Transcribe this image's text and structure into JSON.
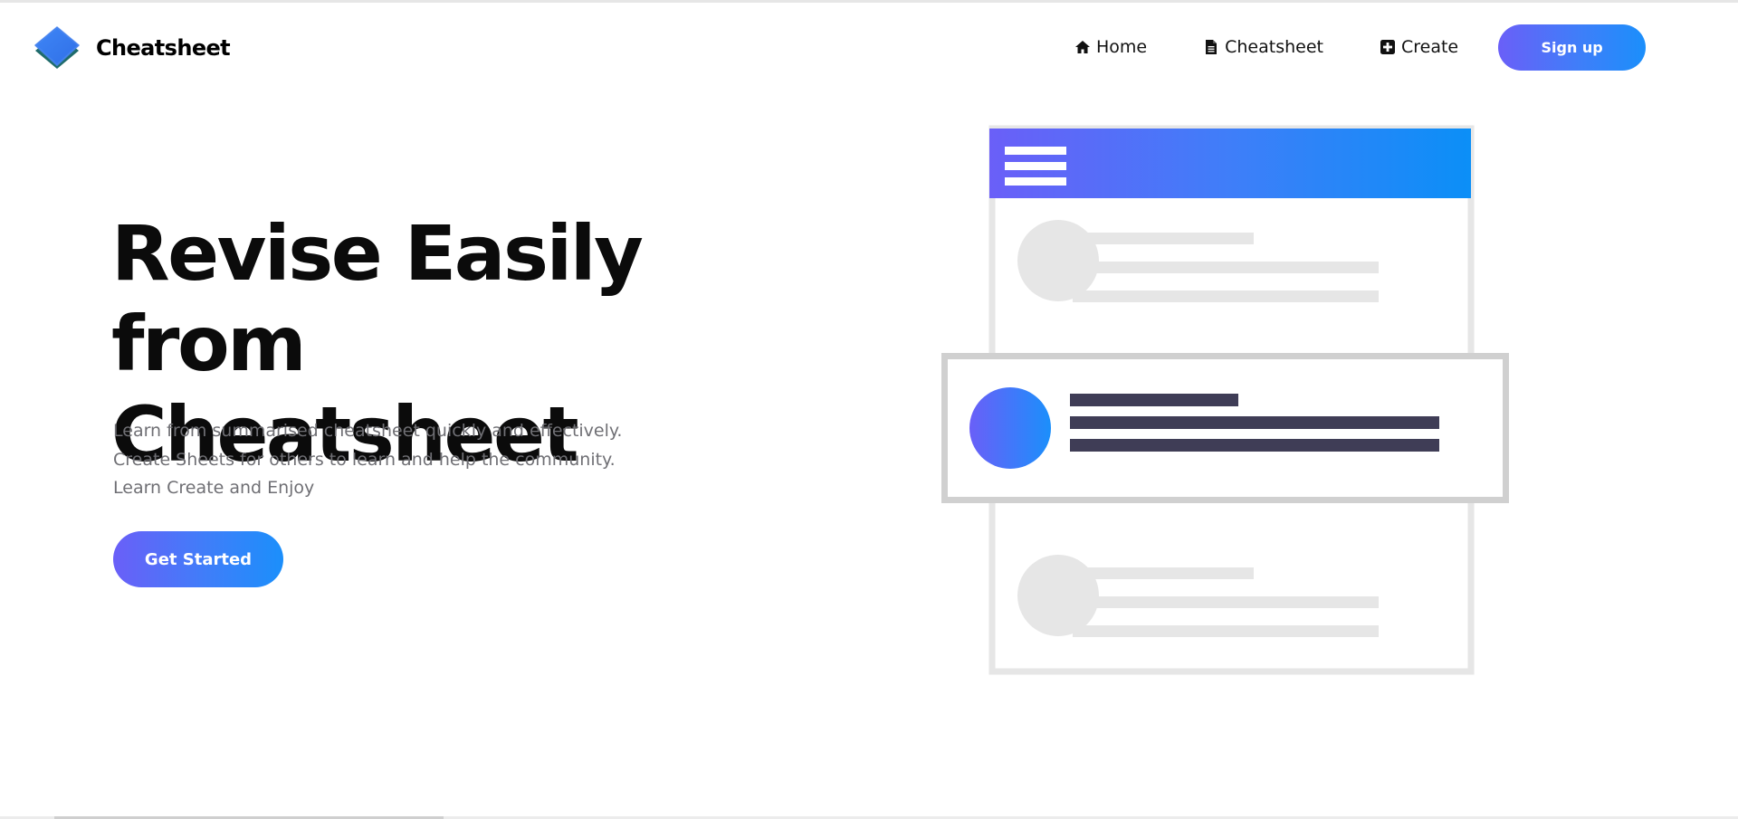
{
  "brand": {
    "name": "Cheatsheet",
    "icon": "layers-icon"
  },
  "nav": {
    "items": [
      {
        "label": "Home",
        "icon": "home-icon"
      },
      {
        "label": "Cheatsheet",
        "icon": "file-icon"
      },
      {
        "label": "Create",
        "icon": "plus-square-icon"
      }
    ],
    "signup_label": "Sign up"
  },
  "hero": {
    "title_line1": "Revise Easily from",
    "title_line2": "Cheatsheet",
    "description": [
      "Learn from summarised cheatsheet quickly and effectively.",
      "Create Sheets for others to learn and help the community.",
      "Learn Create and Enjoy"
    ],
    "cta_label": "Get Started"
  },
  "colors": {
    "gradient_start": "#6a5ff8",
    "gradient_end": "#1b8ffb",
    "dark_bar": "#3f3d56",
    "light_gray": "#e6e6e6",
    "text_muted": "#6f6f74"
  }
}
